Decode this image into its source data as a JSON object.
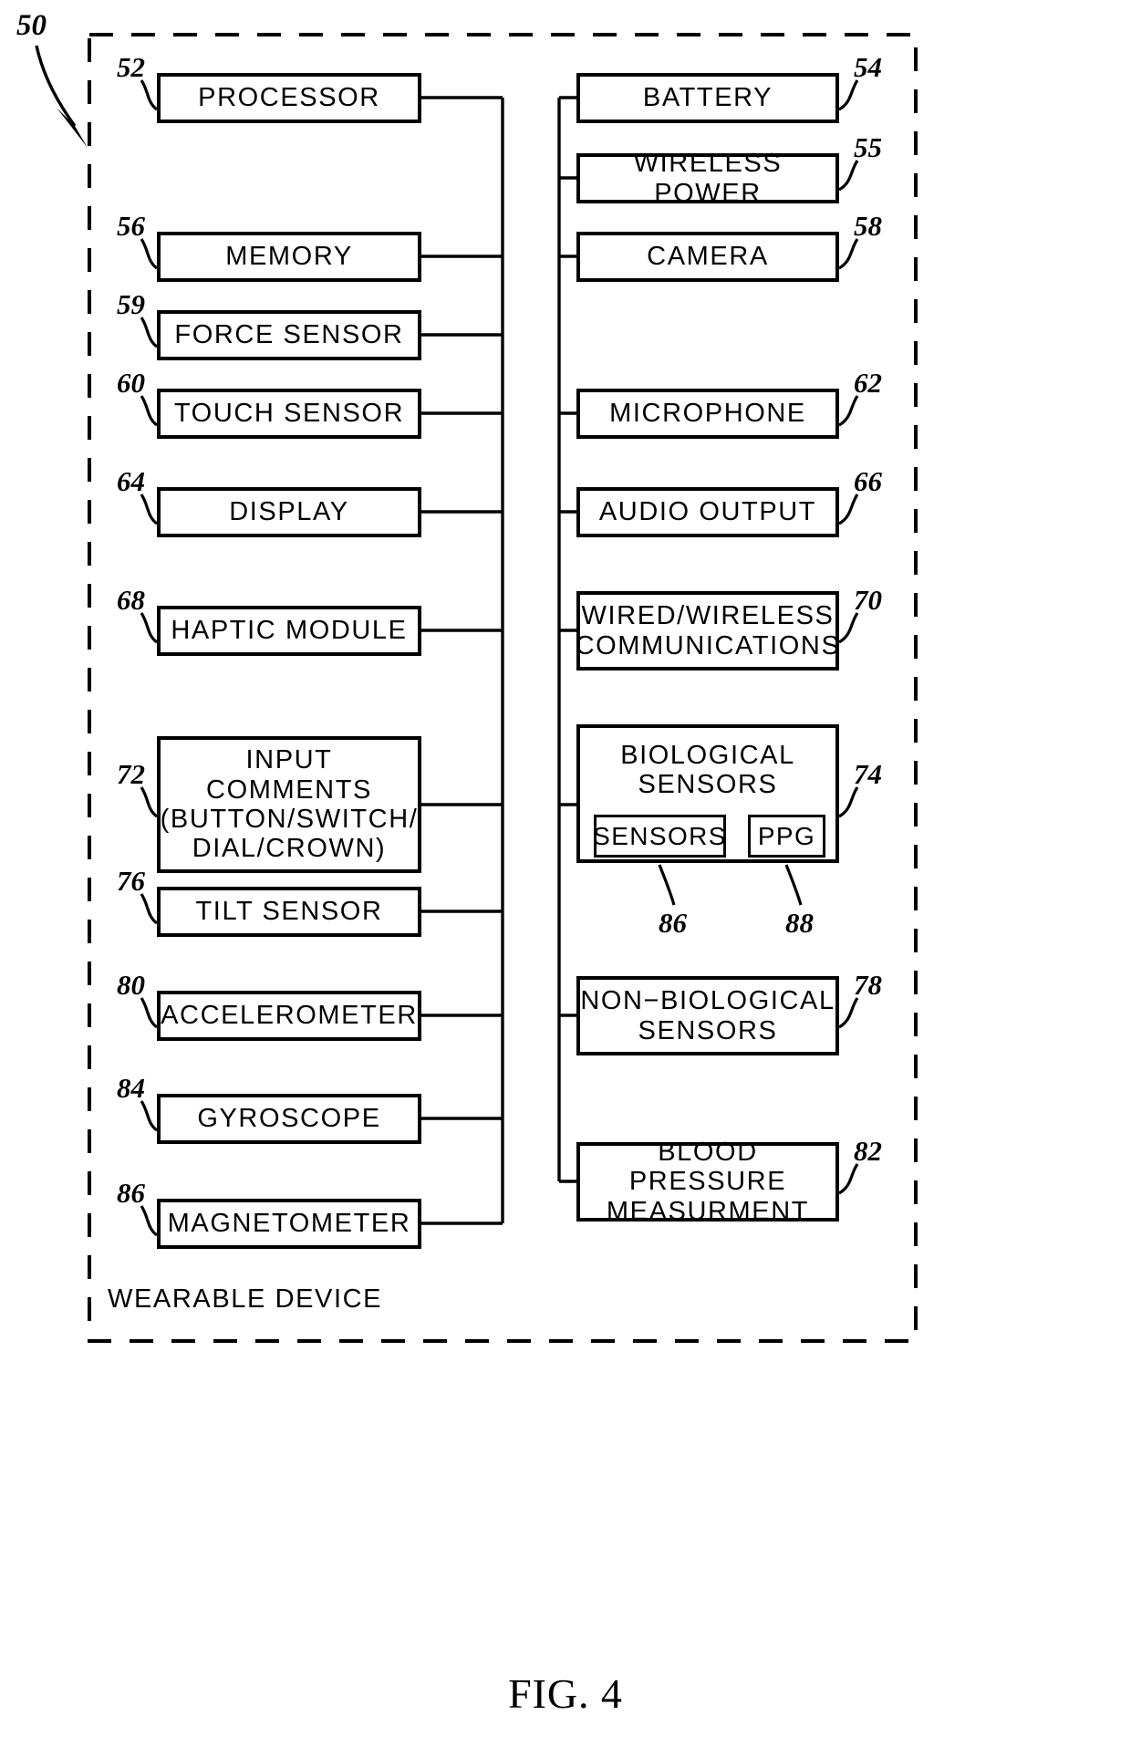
{
  "figure": {
    "caption": "FIG. 4",
    "container_label": "WEARABLE DEVICE",
    "container_ref": "50"
  },
  "nodes": {
    "processor": {
      "label": "PROCESSOR",
      "ref": "52"
    },
    "battery": {
      "label": "BATTERY",
      "ref": "54"
    },
    "wireless_power": {
      "label": "WIRELESS  POWER",
      "ref": "55"
    },
    "memory": {
      "label": "MEMORY",
      "ref": "56"
    },
    "camera": {
      "label": "CAMERA",
      "ref": "58"
    },
    "force_sensor": {
      "label": "FORCE  SENSOR",
      "ref": "59"
    },
    "touch_sensor": {
      "label": "TOUCH  SENSOR",
      "ref": "60"
    },
    "microphone": {
      "label": "MICROPHONE",
      "ref": "62"
    },
    "display": {
      "label": "DISPLAY",
      "ref": "64"
    },
    "audio_output": {
      "label": "AUDIO  OUTPUT",
      "ref": "66"
    },
    "haptic_module": {
      "label": "HAPTIC  MODULE",
      "ref": "68"
    },
    "communications": {
      "label": "WIRED/WIRELESS\nCOMMUNICATIONS",
      "ref": "70"
    },
    "input_components": {
      "label": "INPUT  COMMENTS\n(BUTTON/SWITCH/\nDIAL/CROWN)",
      "ref": "72"
    },
    "biological_sensors": {
      "label": "BIOLOGICAL\nSENSORS",
      "ref": "74"
    },
    "bio_sensors_sub": {
      "label": "SENSORS",
      "ref": "86"
    },
    "bio_ppg_sub": {
      "label": "PPG",
      "ref": "88"
    },
    "tilt_sensor": {
      "label": "TILT  SENSOR",
      "ref": "76"
    },
    "non_biological_sensors": {
      "label": "NON−BIOLOGICAL\nSENSORS",
      "ref": "78"
    },
    "accelerometer": {
      "label": "ACCELEROMETER",
      "ref": "80"
    },
    "gyroscope": {
      "label": "GYROSCOPE",
      "ref": "84"
    },
    "blood_pressure": {
      "label": "BLOOD  PRESSURE\nMEASURMENT",
      "ref": "82"
    },
    "magnetometer": {
      "label": "MAGNETOMETER",
      "ref": "86"
    }
  },
  "colors": {
    "stroke": "#000000",
    "background": "#ffffff"
  }
}
